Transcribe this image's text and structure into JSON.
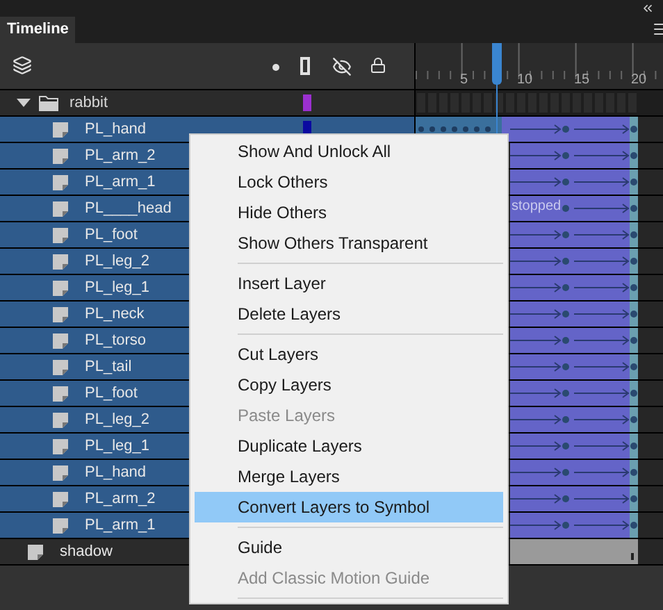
{
  "panel": {
    "title": "Timeline"
  },
  "ruler": {
    "labels": [
      "5",
      "10",
      "15",
      "20"
    ]
  },
  "layers": [
    {
      "kind": "folder",
      "name": "rabbit",
      "expanded": true,
      "color": "#9b30d0",
      "children": [
        {
          "kind": "layer",
          "name": "PL_hand",
          "selected": true,
          "color": "#0a0aa0"
        },
        {
          "kind": "layer",
          "name": "PL_arm_2",
          "selected": true
        },
        {
          "kind": "layer",
          "name": "PL_arm_1",
          "selected": true
        },
        {
          "kind": "layer",
          "name": "PL____head",
          "selected": true,
          "frame_label": "stopped"
        },
        {
          "kind": "layer",
          "name": "PL_foot",
          "selected": true
        },
        {
          "kind": "layer",
          "name": "PL_leg_2",
          "selected": true
        },
        {
          "kind": "layer",
          "name": "PL_leg_1",
          "selected": true
        },
        {
          "kind": "layer",
          "name": "PL_neck",
          "selected": true
        },
        {
          "kind": "layer",
          "name": "PL_torso",
          "selected": true
        },
        {
          "kind": "layer",
          "name": "PL_tail",
          "selected": true
        },
        {
          "kind": "layer",
          "name": "PL_foot",
          "selected": true
        },
        {
          "kind": "layer",
          "name": "PL_leg_2",
          "selected": true
        },
        {
          "kind": "layer",
          "name": "PL_leg_1",
          "selected": true
        },
        {
          "kind": "layer",
          "name": "PL_hand",
          "selected": true
        },
        {
          "kind": "layer",
          "name": "PL_arm_2",
          "selected": true
        },
        {
          "kind": "layer",
          "name": "PL_arm_1",
          "selected": true
        }
      ]
    },
    {
      "kind": "layer",
      "name": "shadow",
      "selected": false
    }
  ],
  "context_menu": [
    {
      "kind": "item",
      "label": "Show And Unlock All",
      "disabled": false,
      "selected": false
    },
    {
      "kind": "item",
      "label": "Lock Others",
      "disabled": false,
      "selected": false
    },
    {
      "kind": "item",
      "label": "Hide Others",
      "disabled": false,
      "selected": false
    },
    {
      "kind": "item",
      "label": "Show Others Transparent",
      "disabled": false,
      "selected": false
    },
    {
      "kind": "separator"
    },
    {
      "kind": "item",
      "label": "Insert Layer",
      "disabled": false,
      "selected": false
    },
    {
      "kind": "item",
      "label": "Delete Layers",
      "disabled": false,
      "selected": false
    },
    {
      "kind": "separator"
    },
    {
      "kind": "item",
      "label": "Cut Layers",
      "disabled": false,
      "selected": false
    },
    {
      "kind": "item",
      "label": "Copy Layers",
      "disabled": false,
      "selected": false
    },
    {
      "kind": "item",
      "label": "Paste Layers",
      "disabled": true,
      "selected": false
    },
    {
      "kind": "item",
      "label": "Duplicate Layers",
      "disabled": false,
      "selected": false
    },
    {
      "kind": "item",
      "label": "Merge Layers",
      "disabled": false,
      "selected": false
    },
    {
      "kind": "item",
      "label": "Convert Layers to Symbol",
      "disabled": false,
      "selected": true
    },
    {
      "kind": "separator"
    },
    {
      "kind": "item",
      "label": "Guide",
      "disabled": false,
      "selected": false
    },
    {
      "kind": "item",
      "label": "Add Classic Motion Guide",
      "disabled": true,
      "selected": false
    },
    {
      "kind": "separator"
    }
  ]
}
